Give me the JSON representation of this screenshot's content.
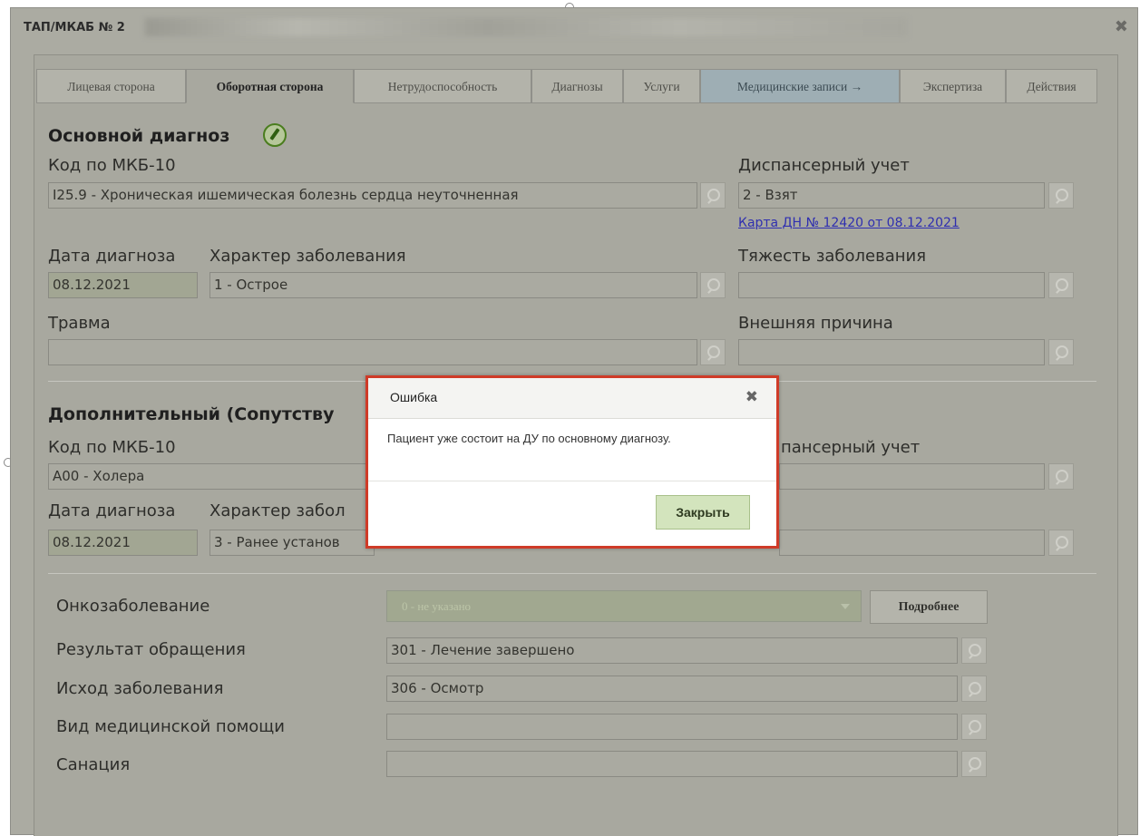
{
  "window": {
    "title": "ТАП/МКАБ № 2",
    "close_icon": "close-icon"
  },
  "tabs": [
    {
      "label": "Лицевая сторона"
    },
    {
      "label": "Оборотная сторона"
    },
    {
      "label": "Нетрудоспособность"
    },
    {
      "label": "Диагнозы"
    },
    {
      "label": "Услуги"
    },
    {
      "label": "Медицинские записи →"
    },
    {
      "label": "Экспертиза"
    },
    {
      "label": "Действия"
    }
  ],
  "main_diagnosis": {
    "title": "Основной диагноз",
    "icd_label": "Код по МКБ-10",
    "icd_value": "I25.9 - Хроническая ишемическая болезнь сердца неуточненная",
    "dispensary_label": "Диспансерный учет",
    "dispensary_value": "2 - Взят",
    "card_link": "Карта ДН № 12420 от 08.12.2021",
    "date_label": "Дата диагноза",
    "date_value": "08.12.2021",
    "nature_label": "Характер заболевания",
    "nature_value": "1 - Острое",
    "severity_label": "Тяжесть заболевания",
    "severity_value": "",
    "trauma_label": "Травма",
    "trauma_value": "",
    "external_label": "Внешняя причина",
    "external_value": ""
  },
  "additional_diagnosis": {
    "title": "Дополнительный (Сопутству",
    "icd_label": "Код по МКБ-10",
    "icd_value": "A00 - Холера",
    "dispensary_label": "пансерный учет",
    "date_label": "Дата диагноза",
    "date_value": "08.12.2021",
    "nature_label": "Характер забол",
    "nature_value": "3 - Ранее установ"
  },
  "outcome": {
    "onco_label": "Онкозаболевание",
    "onco_value": "0 - не указано",
    "more_button": "Подробнее",
    "result_label": "Результат обращения",
    "result_value": "301 - Лечение завершено",
    "exodus_label": "Исход заболевания",
    "exodus_value": "306 - Осмотр",
    "care_type_label": "Вид медицинской помощи",
    "care_type_value": "",
    "sanation_label": "Санация",
    "sanation_value": ""
  },
  "dialog": {
    "title": "Ошибка",
    "message": "Пациент уже состоит на ДУ по основному диагнозу.",
    "close_button": "Закрыть"
  },
  "colors": {
    "dialog_border": "#cf3b28",
    "close_button_bg": "#d3e4bd",
    "link": "#2f2fb0"
  }
}
